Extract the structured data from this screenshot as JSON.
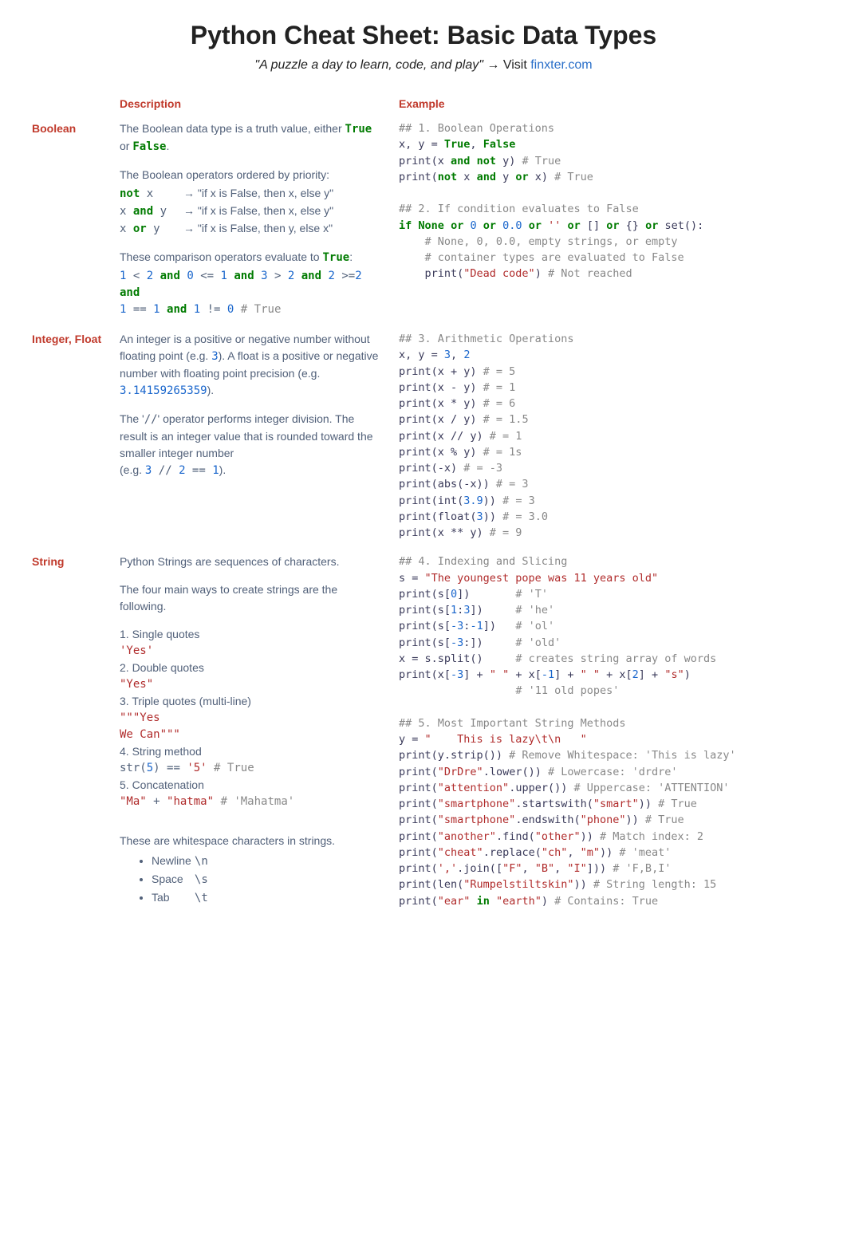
{
  "header": {
    "title": "Python Cheat Sheet: Basic Data Types",
    "tagline": "\"A puzzle a day to learn, code, and play\"",
    "arrow": "→",
    "visit": "Visit",
    "link": "finxter.com"
  },
  "columns": {
    "desc": "Description",
    "example": "Example"
  },
  "rows": {
    "boolean": {
      "label": "Boolean",
      "p1a": "The Boolean data type is a truth value, either ",
      "p1_true": "True",
      "p1_or": " or ",
      "p1_false": "False",
      "p1b": ".",
      "p2": "The Boolean operators ordered by priority:",
      "op_not_l": "not x",
      "op_not_r": "→ \"if x is False, then x, else y\"",
      "op_and_l": "x and y",
      "op_and_r": "→ \"if x is False, then x, else y\"",
      "op_or_l": "x or y",
      "op_or_r": "→ \"if x is False, then y, else x\"",
      "p3a": "These comparison operators evaluate to ",
      "p3_true": "True",
      "p3b": ":",
      "cmp": "1 < 2 and 0 <= 1 and 3 > 2 and 2 >=2 and 1 == 1 and 1 != 0 # True"
    },
    "intfloat": {
      "label": "Integer, Float",
      "p1a": "An integer is a positive or negative number without floating point (e.g. ",
      "p1_3": "3",
      "p1b": "). A float is a positive or negative number with floating point precision (e.g. ",
      "p1_pi": " 3.14159265359",
      "p1c": ").",
      "p2a": "The '",
      "p2_op": "//",
      "p2b": "' operator performs integer division. The result is an integer value that is rounded toward the smaller integer number",
      "p2c": "(e.g. ",
      "p2_ex": "3 // 2 == 1",
      "p2d": ")."
    },
    "string": {
      "label": "String",
      "p1": "Python Strings are sequences of characters.",
      "p2": "The four main ways to create strings are the following.",
      "m1": "1. Single quotes",
      "m1c": "'Yes'",
      "m2": "2. Double quotes",
      "m2c": "\"Yes\"",
      "m3": "3. Triple quotes (multi-line)",
      "m3c": "\"\"\"Yes\nWe Can\"\"\"",
      "m4": "4. String method",
      "m4c": "str(5) == '5' # True",
      "m5": "5. Concatenation",
      "m5c": "\"Ma\" + \"hatma\" # 'Mahatma'",
      "ws_intro": "These are whitespace characters in strings.",
      "ws": {
        "n_name": "Newline",
        "n_esc": "\\n",
        "s_name": "Space",
        "s_esc": "\\s",
        "t_name": "Tab",
        "t_esc": "\\t"
      }
    }
  }
}
